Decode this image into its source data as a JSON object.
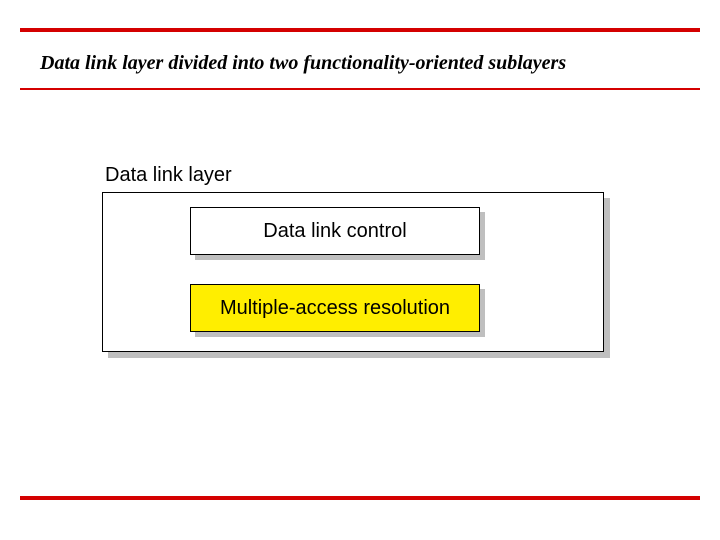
{
  "title": "Data link layer divided into two functionality-oriented sublayers",
  "diagram": {
    "label": "Data link layer",
    "sublayers": [
      {
        "name": "Data link control"
      },
      {
        "name": "Multiple-access resolution"
      }
    ]
  },
  "colors": {
    "rule": "#d40000",
    "highlight": "#ffee00"
  }
}
